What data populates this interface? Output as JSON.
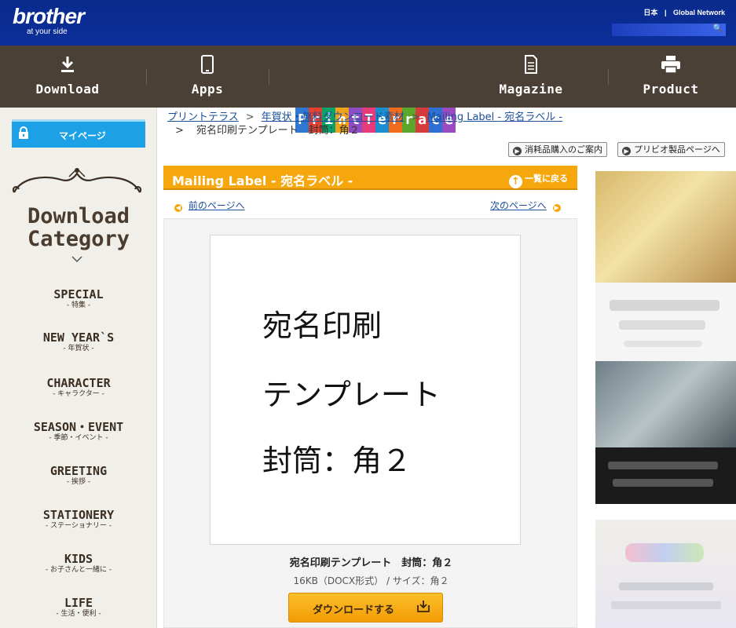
{
  "header": {
    "brand": "brother",
    "tagline": "at your side",
    "country_link": "日本",
    "divider": "|",
    "global_link": "Global Network"
  },
  "nav": {
    "items": [
      {
        "label": "Download",
        "icon": "download-icon"
      },
      {
        "label": "Apps",
        "icon": "smartphone-icon"
      },
      {
        "label": "Magazine",
        "icon": "document-icon"
      },
      {
        "label": "Product",
        "icon": "printer-icon"
      }
    ],
    "logo_letters": [
      "P",
      "r",
      "i",
      "n",
      "t",
      "T",
      "e",
      "r",
      "r",
      "a",
      "c",
      "e"
    ],
    "logo_colors": [
      "#2f77d0",
      "#e3402f",
      "#0aa26a",
      "#f0a21a",
      "#8e4cc2",
      "#e63a7a",
      "#1a8ed0",
      "#f26a1b",
      "#5aa72c",
      "#d43c3c",
      "#2e6fd3",
      "#9b4bc0"
    ]
  },
  "sidebar": {
    "mypage": "マイページ",
    "title_line1": "Download",
    "title_line2": "Category",
    "categories": [
      {
        "en": "SPECIAL",
        "jp": "- 特集 -"
      },
      {
        "en": "NEW YEAR`S",
        "jp": "- 年賀状 -"
      },
      {
        "en": "CHARACTER",
        "jp": "- キャラクター -"
      },
      {
        "en": "SEASON・EVENT",
        "jp": "- 季節・イベント -"
      },
      {
        "en": "GREETING",
        "jp": "- 挨拶 -"
      },
      {
        "en": "STATIONERY",
        "jp": "- ステーショナリー -"
      },
      {
        "en": "KIDS",
        "jp": "- お子さんと一緒に -"
      },
      {
        "en": "LIFE",
        "jp": "- 生活・便利 -"
      }
    ]
  },
  "breadcrumb": {
    "items": [
      "プリントテラス",
      "年賀状・無料ダウンロード素材",
      "Mailing Label - 宛名ラベル -"
    ],
    "current": "宛名印刷テンプレート　封筒：角２",
    "sep": ">"
  },
  "buttons": {
    "supplies": "消耗品購入のご案内",
    "privio": "プリビオ製品ページへ"
  },
  "section": {
    "title": "Mailing Label - 宛名ラベル -",
    "back_to_list": "一覧に戻る",
    "prev": "前のページへ",
    "next": "次のページへ"
  },
  "item": {
    "preview_lines": [
      "宛名印刷",
      "テンプレート",
      "封筒：角２"
    ],
    "name": "宛名印刷テンプレート　封筒：角２",
    "meta": "16KB（DOCX形式） / サイズ：角２",
    "download": "ダウンロードする"
  },
  "colors": {
    "topbar": "#0b2f9a",
    "navbar": "#4a4036",
    "accent": "#f6a70d",
    "mypage": "#1ca0e6"
  }
}
